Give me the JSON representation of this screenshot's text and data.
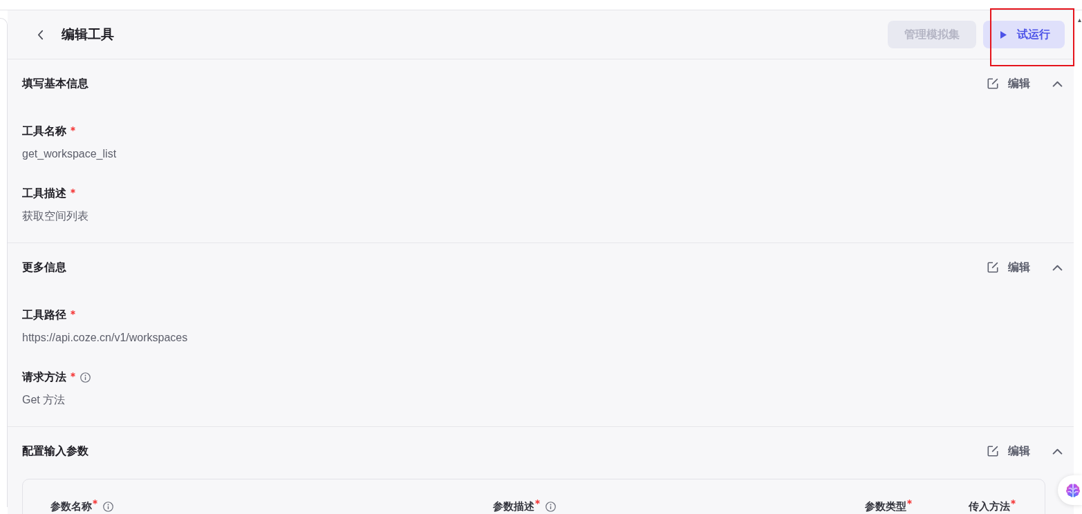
{
  "header": {
    "title": "编辑工具",
    "buttons": [
      {
        "kind": "secondary",
        "label": "管理模拟集",
        "disabled": true
      },
      {
        "kind": "run",
        "label": "试运行",
        "disabled": false
      }
    ]
  },
  "sections": [
    {
      "title": "填写基本信息",
      "action": "编辑",
      "expanded": true,
      "fields": [
        {
          "label": "工具名称",
          "required": true,
          "info": false,
          "value": "get_workspace_list"
        },
        {
          "label": "工具描述",
          "required": true,
          "info": false,
          "value": "获取空间列表"
        }
      ]
    },
    {
      "title": "更多信息",
      "action": "编辑",
      "expanded": true,
      "fields": [
        {
          "label": "工具路径",
          "required": true,
          "info": false,
          "value": "https://api.coze.cn/v1/workspaces"
        },
        {
          "label": "请求方法",
          "required": true,
          "info": true,
          "value": "Get 方法"
        }
      ]
    },
    {
      "title": "配置输入参数",
      "action": "编辑",
      "expanded": true,
      "table": {
        "columns": [
          {
            "label": "参数名称",
            "required": true,
            "info": true
          },
          {
            "label": "参数描述",
            "required": true,
            "info": true
          },
          {
            "label": "参数类型",
            "required": true,
            "info": false
          },
          {
            "label": "传入方法",
            "required": true,
            "info": false
          }
        ]
      }
    }
  ]
}
